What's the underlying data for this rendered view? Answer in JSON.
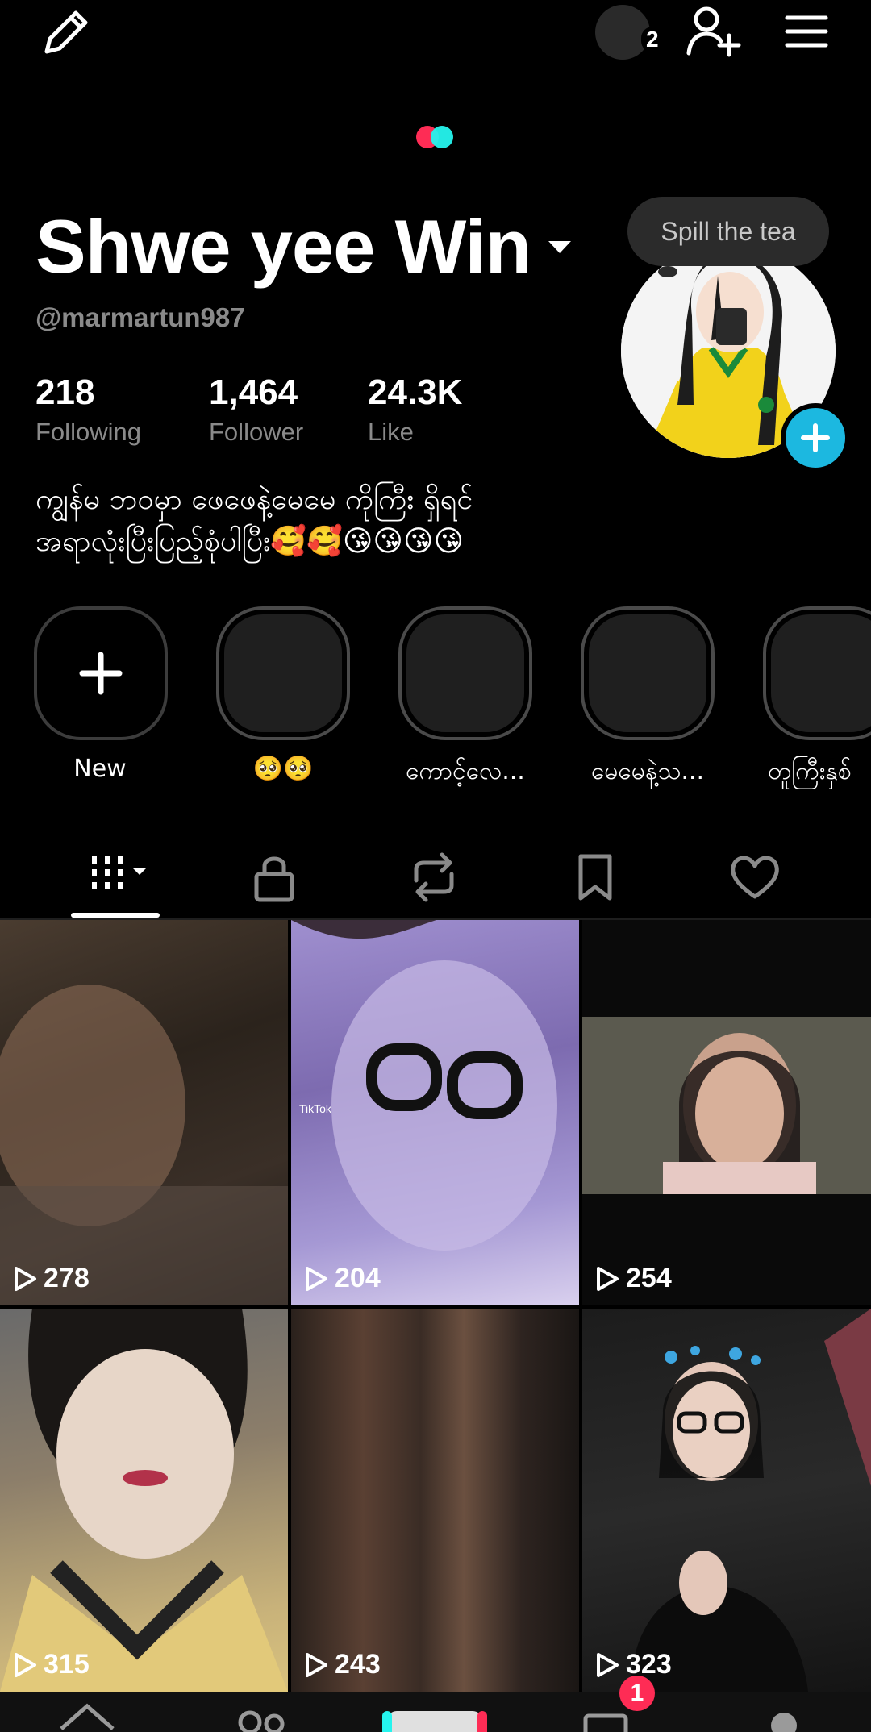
{
  "profile": {
    "name": "Shwe yee Win",
    "handle": "@marmartun987",
    "bio_line1": "ကျွန်မ ဘဝမှာ ဖေဖေနဲ့မေမေ ကိုကြီး ရှိရင်",
    "bio_line2": "အရာလုံးပြီးပြည့်စုံပါပြီး🥰🥰😘😘😘😘",
    "tooltip": "Spill the tea",
    "story_count": "2"
  },
  "stats": [
    {
      "value": "218",
      "label": "Following"
    },
    {
      "value": "1,464",
      "label": "Follower"
    },
    {
      "value": "24.3K",
      "label": "Like"
    }
  ],
  "highlights": [
    {
      "label": "New"
    },
    {
      "label": "🥺🥺"
    },
    {
      "label": "ကောင့်လေ..."
    },
    {
      "label": "မေမေနဲ့သ..."
    },
    {
      "label": "တူကြီးနှစ်"
    }
  ],
  "videos": [
    {
      "views": "278"
    },
    {
      "views": "204"
    },
    {
      "views": "254"
    },
    {
      "views": "315"
    },
    {
      "views": "243"
    },
    {
      "views": "323"
    }
  ],
  "watermark": "TikTok",
  "nav": {
    "inbox_badge": "1"
  },
  "colors": {
    "accent_blue": "#1cb8e0",
    "logo_red": "#fe2c55",
    "logo_cyan": "#25f4ee",
    "badge_red": "#fe2c55"
  }
}
